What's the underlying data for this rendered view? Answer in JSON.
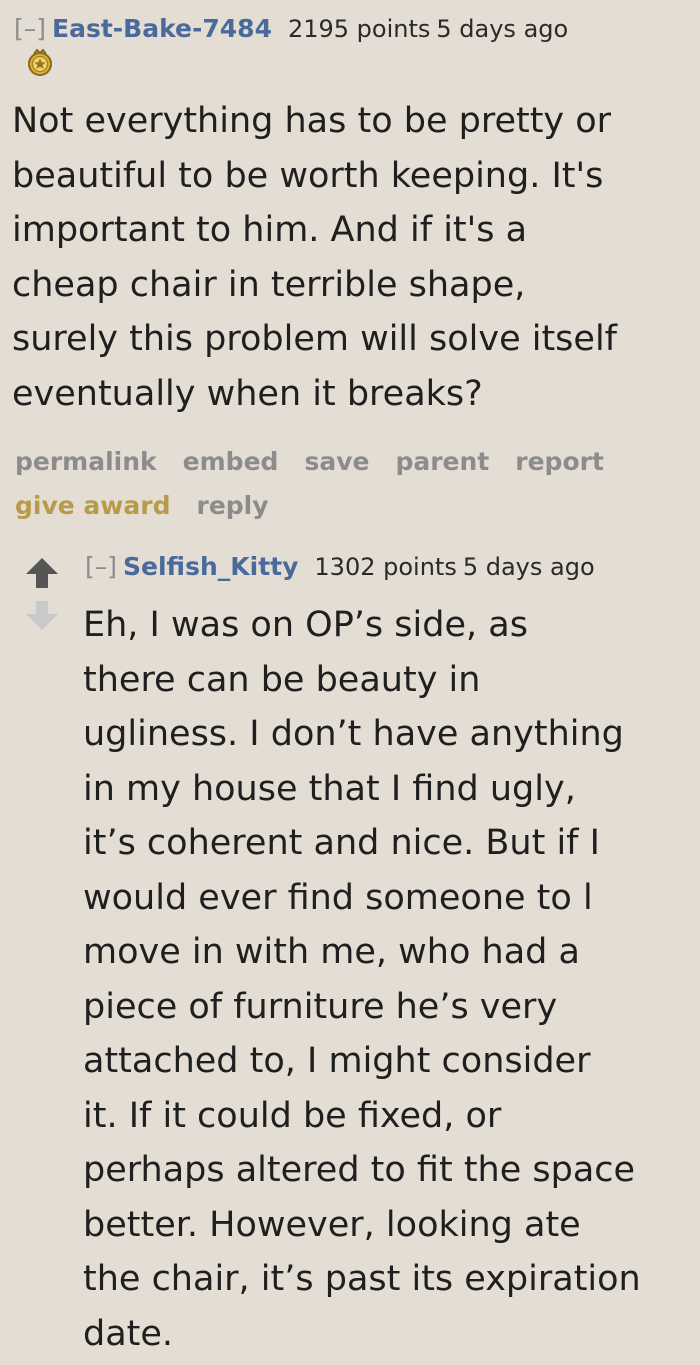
{
  "comments": [
    {
      "expand_label": "[–]",
      "author": "East-Bake-7484",
      "score": "2195 points",
      "time": "5 days ago",
      "award_icon": "award-medal-icon",
      "body_lines": [
        "Not everything has to be pretty or",
        "beautiful to be worth keeping. It's",
        "important to him. And if it's a",
        "cheap chair in terrible shape,",
        "surely this problem will solve itself",
        "eventually when it breaks?"
      ],
      "buttons": {
        "permalink": "permalink",
        "embed": "embed",
        "save": "save",
        "parent": "parent",
        "report": "report",
        "give_award": "give award",
        "reply": "reply"
      }
    },
    {
      "expand_label": "[–]",
      "author": "Selfish_Kitty",
      "score": "1302 points",
      "time": "5 days ago",
      "upvote_icon": "upvote-arrow-icon",
      "downvote_icon": "downvote-arrow-icon",
      "body_lines": [
        "Eh, I was on OP’s side, as",
        "there can be beauty in",
        "ugliness. I don’t have anything",
        "in my house that I find ugly,",
        "it’s coherent and nice. But if I",
        "would ever find someone to l",
        "move in with me, who had a",
        "piece of furniture he’s very",
        "attached to, I might consider",
        "it. If it could be fixed, or",
        "perhaps altered to fit the space",
        "better. However, looking ate",
        "the chair, it’s past its expiration",
        "date."
      ]
    }
  ],
  "colors": {
    "background": "#e4ddd3",
    "author": "#4a6a9c",
    "muted": "#8c8c8c",
    "gold": "#b79b4a"
  }
}
